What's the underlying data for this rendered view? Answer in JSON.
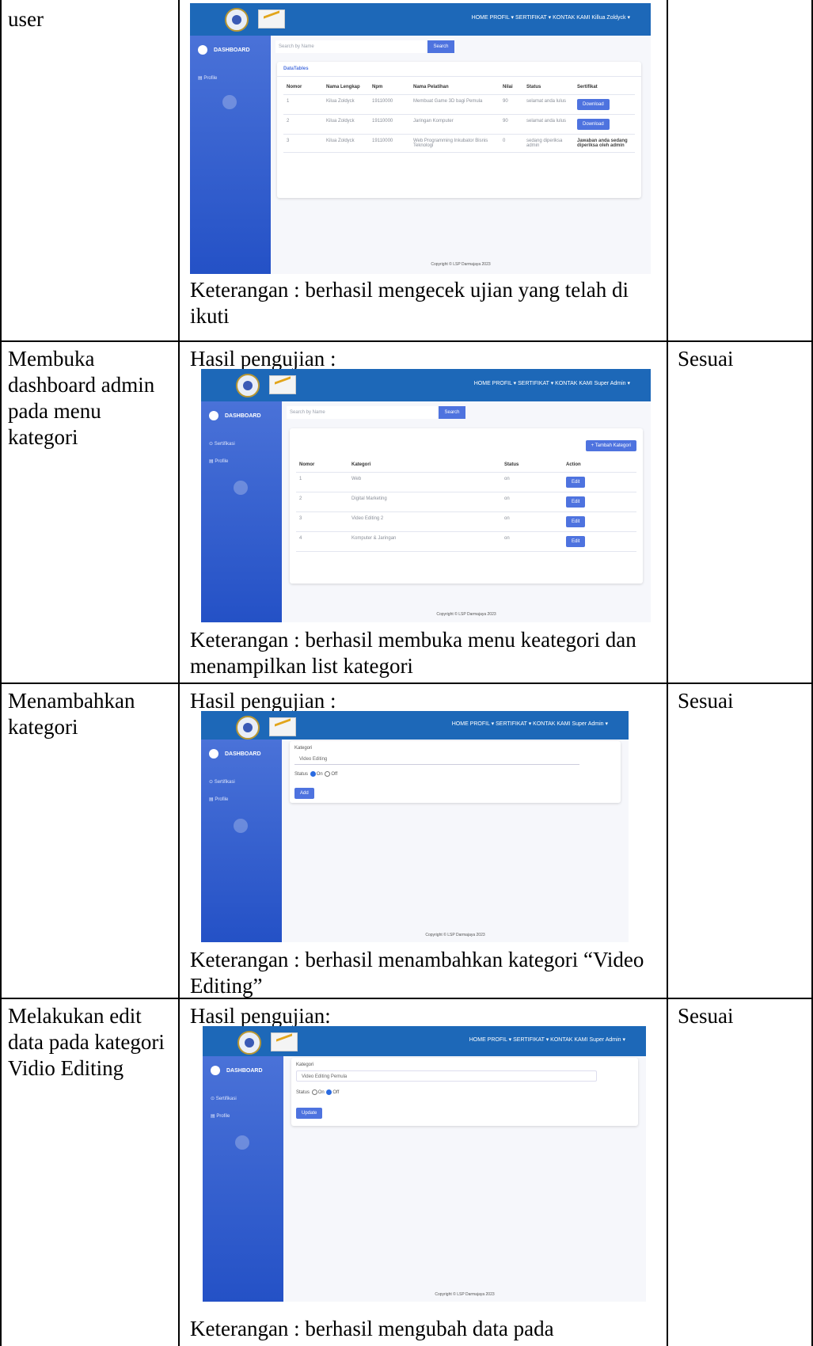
{
  "rows": [
    {
      "skenario": "user",
      "hasil_title": "",
      "keterangan": "Keterangan : berhasil mengecek ujian yang telah di ikuti",
      "status": ""
    },
    {
      "skenario": "Membuka dashboard admin pada menu kategori",
      "hasil_title": "Hasil pengujian :",
      "keterangan": "Keterangan : berhasil membuka menu keategori dan menampilkan list kategori",
      "status": "Sesuai"
    },
    {
      "skenario": "Menambahkan kategori",
      "hasil_title": "Hasil pengujian :",
      "keterangan": "Keterangan : berhasil menambahkan kategori “Video Editing”",
      "status": "Sesuai"
    },
    {
      "skenario": "Melakukan edit data pada kategori Vidio Editing",
      "hasil_title": "Hasil pengujian:",
      "keterangan": "Keterangan : berhasil mengubah data pada",
      "status": "Sesuai"
    }
  ],
  "app": {
    "nav_user": "HOME  PROFIL ▾  SERTIFIKAT ▾  KONTAK KAMI  Killua Zoldyck ▾",
    "nav_admin": "HOME  PROFIL ▾  SERTIFIKAT ▾  KONTAK KAMI  Super Admin ▾",
    "brand": "DASHBOARD",
    "sidebar_sertifikasi": "⊙  Sertifikasi",
    "sidebar_profile": "▤  Profile",
    "search_placeholder": "Search by Name",
    "search_button": "Search",
    "footer": "Copyright © LSP Darmajaya 2023",
    "datatables_title": "DataTables",
    "ujian_headers": [
      "Nomor",
      "Nama Lengkap",
      "Npm",
      "Nama Pelatihan",
      "Nilai",
      "Status",
      "Sertifikat"
    ],
    "ujian_rows": [
      {
        "no": "1",
        "nama": "Kilua Zoldyck",
        "npm": "19110000",
        "pelatihan": "Membuat Game 3D bagi Pemula",
        "nilai": "90",
        "status": "selamat anda lulus",
        "sertifikat": "Download"
      },
      {
        "no": "2",
        "nama": "Kilua Zoldyck",
        "npm": "19110000",
        "pelatihan": "Jaringan Komputer",
        "nilai": "90",
        "status": "selamat anda lulus",
        "sertifikat": "Download"
      },
      {
        "no": "3",
        "nama": "Kilua Zoldyck",
        "npm": "19110000",
        "pelatihan": "Web Programming Inkubator Bisnis Teknologi",
        "nilai": "0",
        "status": "sedang diperiksa admin",
        "sertifikat": "Jawaban anda sedang diperiksa oleh admin"
      }
    ],
    "tambah_button": "+ Tambah Kategori",
    "kategori_headers": [
      "Nomor",
      "Kategori",
      "Status",
      "Action"
    ],
    "kategori_rows": [
      {
        "no": "1",
        "kategori": "Web",
        "status": "on",
        "action": "Edit"
      },
      {
        "no": "2",
        "kategori": "Digital Marketing",
        "status": "on",
        "action": "Edit"
      },
      {
        "no": "3",
        "kategori": "Video Editing 2",
        "status": "on",
        "action": "Edit"
      },
      {
        "no": "4",
        "kategori": "Komputer & Jaringan",
        "status": "on",
        "action": "Edit"
      }
    ],
    "form_label": "Kategori",
    "form_add_value": "Video Editing",
    "form_edit_value": "Video Editing Pemula",
    "status_label": "Status",
    "on_label": "On",
    "off_label": "Off",
    "add_button": "Add",
    "update_button": "Update"
  }
}
